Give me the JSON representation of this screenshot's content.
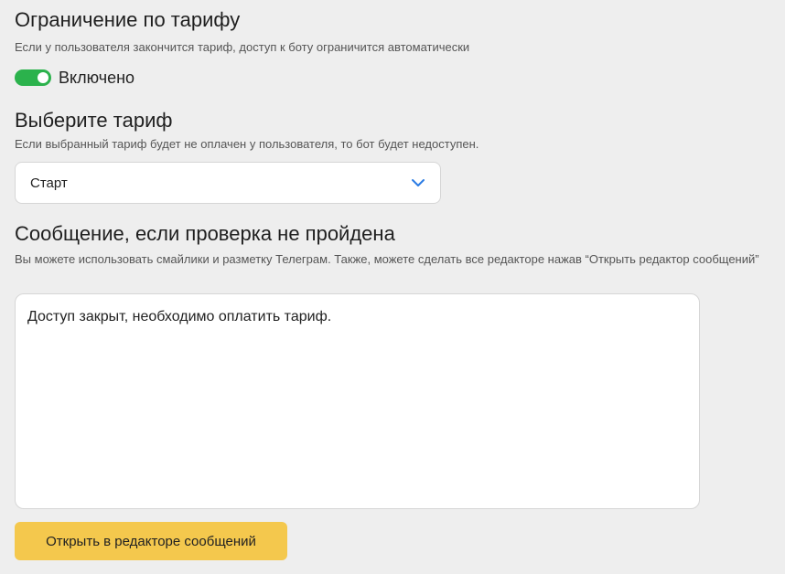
{
  "tariff_limit": {
    "title": "Ограничение по тарифу",
    "description": "Если у пользователя закончится тариф, доступ к боту ограничится автоматически",
    "toggle_state": true,
    "toggle_label": "Включено",
    "toggle_color": "#2bb24c"
  },
  "tariff_select": {
    "title": "Выберите тариф",
    "description": "Если выбранный тариф будет не оплачен у пользователя, то бот будет недоступен.",
    "selected": "Старт",
    "chevron_icon": "chevron-down-icon",
    "chevron_color": "#2a7be4"
  },
  "fail_message": {
    "title": "Сообщение, если проверка не пройдена",
    "description": "Вы можете использовать смайлики и разметку Телеграм. Также, можете сделать все редакторе нажав “Открыть редактор сообщений”",
    "value": "Доступ закрыт, необходимо оплатить тариф.",
    "editor_button_label": "Открыть в редакторе сообщений",
    "editor_button_color": "#f4c84d"
  }
}
